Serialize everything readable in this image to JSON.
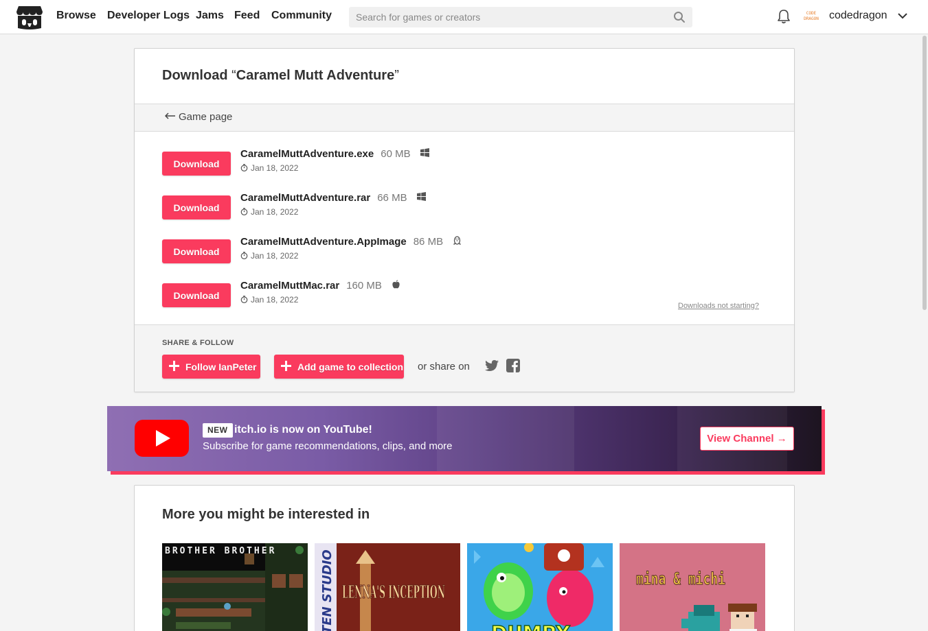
{
  "header": {
    "nav": [
      "Browse",
      "Developer Logs",
      "Jams",
      "Feed",
      "Community"
    ],
    "search_placeholder": "Search for games or creators",
    "avatar_text": "CODE DRAGON",
    "username": "codedragon"
  },
  "page": {
    "title_prefix": "Download",
    "title_open_quote": "“",
    "game_title": "Caramel Mutt Adventure",
    "title_close_quote": "”",
    "back_link": "Game page"
  },
  "uploads": [
    {
      "button": "Download",
      "filename": "CaramelMuttAdventure.exe",
      "size": "60 MB",
      "platform": "windows-icon",
      "date": "Jan 18, 2022"
    },
    {
      "button": "Download",
      "filename": "CaramelMuttAdventure.rar",
      "size": "66 MB",
      "platform": "windows-icon",
      "date": "Jan 18, 2022"
    },
    {
      "button": "Download",
      "filename": "CaramelMuttAdventure.AppImage",
      "size": "86 MB",
      "platform": "linux-icon",
      "date": "Jan 18, 2022"
    },
    {
      "button": "Download",
      "filename": "CaramelMuttMac.rar",
      "size": "160 MB",
      "platform": "apple-icon",
      "date": "Jan 18, 2022"
    }
  ],
  "downloads_not_starting": "Downloads not starting?",
  "share": {
    "label": "SHARE & FOLLOW",
    "follow_button": "Follow IanPeter",
    "collection_button": "Add game to collection",
    "or_share_on": "or share on"
  },
  "youtube_banner": {
    "badge": "NEW",
    "title": "itch.io is now on YouTube!",
    "subtitle": "Subscribe for game recommendations, clips, and more",
    "button": "View Channel →"
  },
  "more": {
    "heading": "More you might be interested in",
    "games": [
      {
        "art_text": "BROTHER BROTHER"
      },
      {
        "art_text": "LENNA'S INCEPTION",
        "side_text": "TEN STUDIO"
      },
      {
        "art_text": "DUMPY"
      },
      {
        "art_text": "mina & michi"
      }
    ]
  },
  "colors": {
    "accent": "#fa3b5e",
    "page_bg": "#f4f4f4",
    "youtube_red": "#ff0000"
  }
}
